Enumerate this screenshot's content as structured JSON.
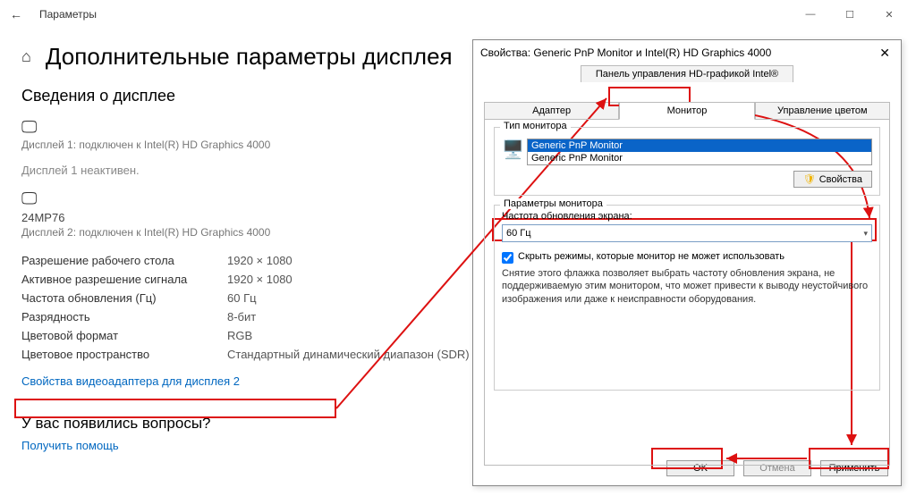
{
  "window": {
    "title": "Параметры",
    "heading": "Дополнительные параметры дисплея",
    "section": "Сведения о дисплее"
  },
  "display1": {
    "name": "Дисплей 1: подключен к Intel(R) HD Graphics 4000",
    "inactive": "Дисплей 1 неактивен."
  },
  "display2": {
    "model": "24MP76",
    "name": "Дисплей 2: подключен к Intel(R) HD Graphics 4000"
  },
  "specs": {
    "desktop_res_label": "Разрешение рабочего стола",
    "desktop_res_value": "1920 × 1080",
    "active_res_label": "Активное разрешение сигнала",
    "active_res_value": "1920 × 1080",
    "refresh_label": "Частота обновления (Гц)",
    "refresh_value": "60 Гц",
    "depth_label": "Разрядность",
    "depth_value": "8-бит",
    "color_format_label": "Цветовой формат",
    "color_format_value": "RGB",
    "color_space_label": "Цветовое пространство",
    "color_space_value": "Стандартный динамический диапазон (SDR)"
  },
  "links": {
    "adapter_props": "Свойства видеоадаптера для дисплея 2",
    "question": "У вас появились вопросы?",
    "get_help": "Получить помощь"
  },
  "dialog": {
    "title": "Свойства: Generic PnP Monitor и Intel(R) HD Graphics 4000",
    "intel_tab": "Панель управления HD-графикой Intel®",
    "tabs": {
      "adapter": "Адаптер",
      "monitor": "Монитор",
      "color": "Управление цветом"
    },
    "group1": {
      "title": "Тип монитора",
      "items": [
        "Generic PnP Monitor",
        "Generic PnP Monitor"
      ],
      "props_btn": "Свойства"
    },
    "group2": {
      "title": "Параметры монитора",
      "freq_label": "Частота обновления экрана:",
      "freq_value": "60 Гц",
      "hide_modes": "Скрыть режимы, которые монитор не может использовать",
      "desc": "Снятие этого флажка позволяет выбрать частоту обновления экрана, не поддерживаемую этим монитором, что может привести к выводу неустойчивого изображения или даже к неисправности оборудования."
    },
    "buttons": {
      "ok": "OK",
      "cancel": "Отмена",
      "apply": "Применить"
    }
  }
}
